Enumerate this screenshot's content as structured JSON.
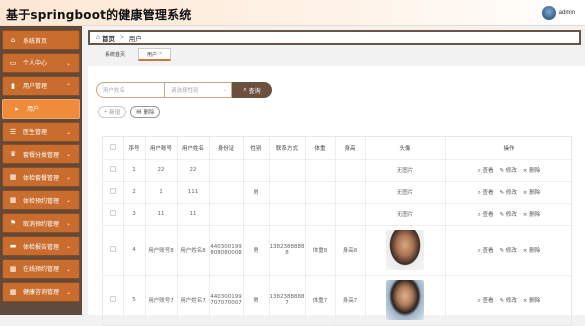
{
  "header": {
    "title": "基于springboot的健康管理系统",
    "user": "admin"
  },
  "sidebar": {
    "items": [
      {
        "label": "系统首页",
        "icon": "home-icon"
      },
      {
        "label": "个人中心",
        "icon": "id-card-icon"
      },
      {
        "label": "用户管理",
        "icon": "clipboard-icon"
      },
      {
        "label": "用户",
        "icon": "caret-right-icon"
      },
      {
        "label": "医生管理",
        "icon": "list-icon"
      },
      {
        "label": "套餐分类管理",
        "icon": "trophy-icon"
      },
      {
        "label": "体检套餐管理",
        "icon": "grid-icon"
      },
      {
        "label": "体检预约管理",
        "icon": "grid-icon"
      },
      {
        "label": "取消预约管理",
        "icon": "flag-icon"
      },
      {
        "label": "体检报告管理",
        "icon": "monitor-icon"
      },
      {
        "label": "在线预约管理",
        "icon": "grid-icon"
      },
      {
        "label": "健康咨询管理",
        "icon": "grid-icon"
      }
    ]
  },
  "breadcrumb": {
    "home": "首页",
    "current": "用户"
  },
  "tabs": [
    {
      "label": "系统首页"
    },
    {
      "label": "用户"
    }
  ],
  "search": {
    "name_placeholder": "用户姓名",
    "gender_placeholder": "请选择性别",
    "query_label": "查询"
  },
  "actions": {
    "add": "新增",
    "delete": "删除"
  },
  "table": {
    "columns": [
      "序号",
      "用户账号",
      "用户姓名",
      "身份证",
      "性别",
      "联系方式",
      "体重",
      "身高",
      "头像",
      "操作"
    ],
    "rows": [
      {
        "index": "1",
        "account": "22",
        "name": "22",
        "id_card": "",
        "gender": "",
        "phone": "",
        "weight": "",
        "height": "",
        "avatar": "无图片",
        "photo": false
      },
      {
        "index": "2",
        "account": "1",
        "name": "111",
        "id_card": "",
        "gender": "男",
        "phone": "",
        "weight": "",
        "height": "",
        "avatar": "无图片",
        "photo": false
      },
      {
        "index": "3",
        "account": "11",
        "name": "11",
        "id_card": "",
        "gender": "",
        "phone": "",
        "weight": "",
        "height": "",
        "avatar": "无图片",
        "photo": false
      },
      {
        "index": "4",
        "account": "用户账号8",
        "name": "用户姓名8",
        "id_card": "440300199808080008",
        "gender": "男",
        "phone": "13823888888",
        "weight": "体重8",
        "height": "身高8",
        "avatar": "",
        "photo": true
      },
      {
        "index": "5",
        "account": "用户账号7",
        "name": "用户姓名7",
        "id_card": "440300199707070007",
        "gender": "男",
        "phone": "13823888887",
        "weight": "体重7",
        "height": "身高7",
        "avatar": "",
        "photo": true
      }
    ],
    "op_view": "查看",
    "op_edit": "修改",
    "op_delete": "删除"
  }
}
